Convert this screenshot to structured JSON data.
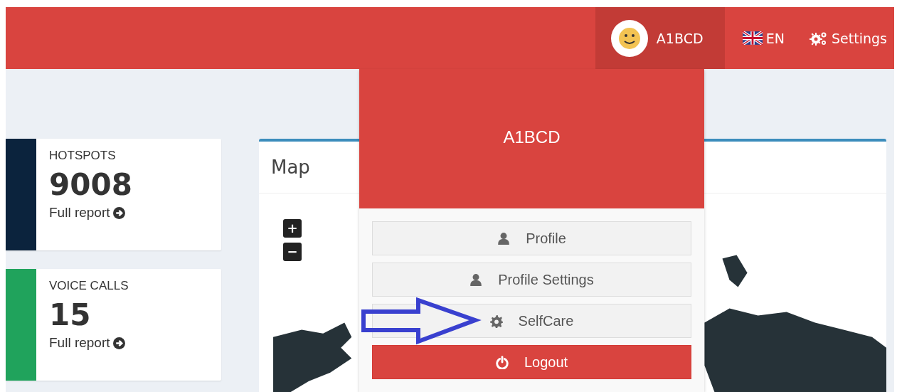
{
  "header": {
    "user": {
      "name": "A1BCD",
      "expanded": true
    },
    "language": {
      "label": "EN"
    },
    "settings": {
      "label": "Settings"
    }
  },
  "stats": [
    {
      "title": "HOTSPOTS",
      "value": "9008",
      "link": "Full report",
      "color": "#0b233d"
    },
    {
      "title": "VOICE CALLS",
      "value": "15",
      "link": "Full report",
      "color": "#20a35c"
    }
  ],
  "map_panel": {
    "title": "Map",
    "zoom_controls": [
      "+",
      "−"
    ]
  },
  "user_menu": {
    "name": "A1BCD",
    "items": [
      {
        "label": "Profile",
        "kind": "profile"
      },
      {
        "label": "Profile Settings",
        "kind": "preferences"
      },
      {
        "label": "SelfCare",
        "kind": "selfcare"
      },
      {
        "label": "Logout",
        "kind": "logout"
      }
    ]
  }
}
